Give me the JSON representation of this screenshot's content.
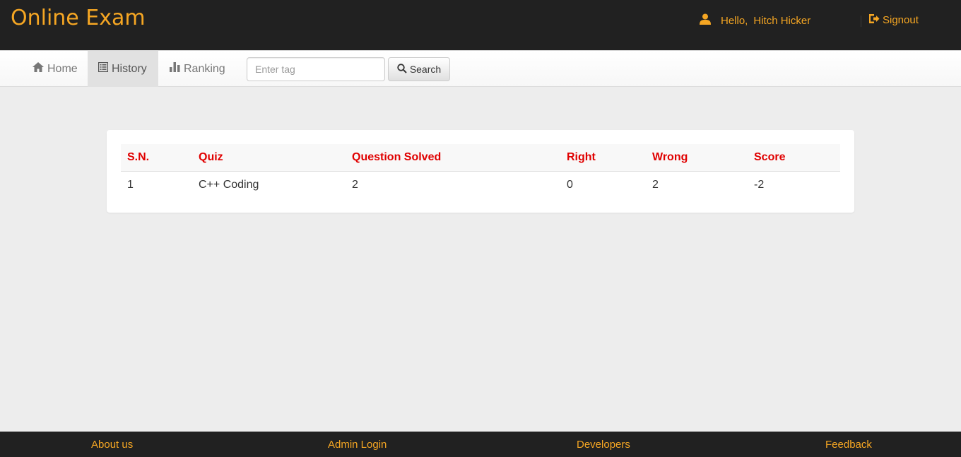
{
  "header": {
    "brand": "Online Exam",
    "greeting": "Hello,",
    "user_name": "Hitch Hicker",
    "signout_label": "Signout",
    "accent_color": "#f5a623",
    "background_color": "#212121"
  },
  "nav": {
    "items": [
      {
        "label": "Home",
        "icon": "home-icon",
        "active": false
      },
      {
        "label": "History",
        "icon": "list-icon",
        "active": true
      },
      {
        "label": "Ranking",
        "icon": "bar-chart-icon",
        "active": false
      }
    ],
    "search": {
      "placeholder": "Enter tag",
      "value": "",
      "button_label": "Search"
    }
  },
  "history_table": {
    "header_color": "#e00000",
    "columns": [
      "S.N.",
      "Quiz",
      "Question Solved",
      "Right",
      "Wrong",
      "Score"
    ],
    "rows": [
      [
        "1",
        "C++ Coding",
        "2",
        "0",
        "2",
        "-2"
      ]
    ]
  },
  "footer": {
    "links": [
      "About us",
      "Admin Login",
      "Developers",
      "Feedback"
    ]
  }
}
